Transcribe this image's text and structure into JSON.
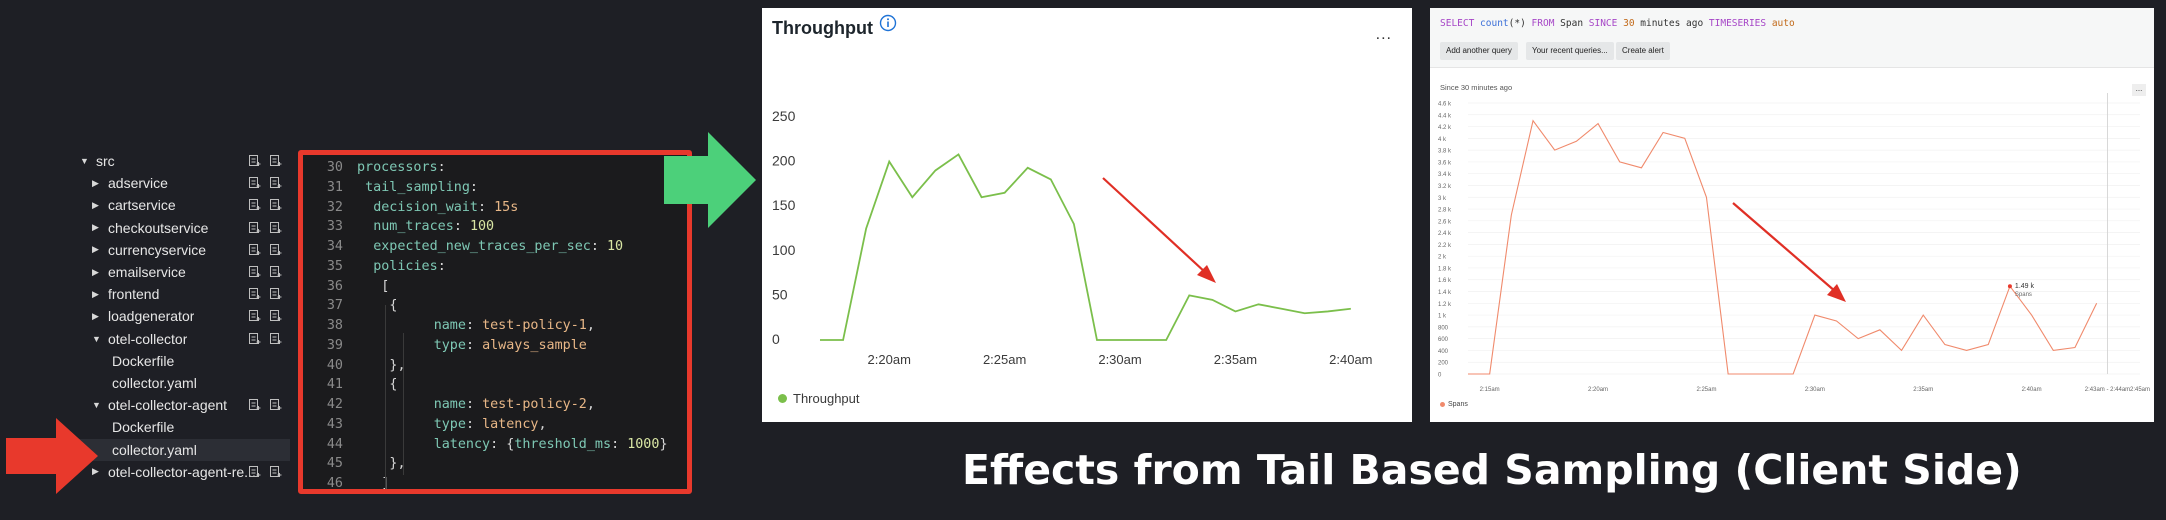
{
  "tree": {
    "items": [
      {
        "label": "src",
        "expanded": true,
        "depth": 0,
        "has_actions": true
      },
      {
        "label": "adservice",
        "expanded": false,
        "depth": 1,
        "has_actions": true
      },
      {
        "label": "cartservice",
        "expanded": false,
        "depth": 1,
        "has_actions": true
      },
      {
        "label": "checkoutservice",
        "expanded": false,
        "depth": 1,
        "has_actions": true
      },
      {
        "label": "currencyservice",
        "expanded": false,
        "depth": 1,
        "has_actions": true
      },
      {
        "label": "emailservice",
        "expanded": false,
        "depth": 1,
        "has_actions": true
      },
      {
        "label": "frontend",
        "expanded": false,
        "depth": 1,
        "has_actions": true
      },
      {
        "label": "loadgenerator",
        "expanded": false,
        "depth": 1,
        "has_actions": true
      },
      {
        "label": "otel-collector",
        "expanded": true,
        "depth": 1,
        "has_actions": true
      },
      {
        "label": "Dockerfile",
        "expanded": null,
        "depth": 2,
        "has_actions": false
      },
      {
        "label": "collector.yaml",
        "expanded": null,
        "depth": 2,
        "has_actions": false
      },
      {
        "label": "otel-collector-agent",
        "expanded": true,
        "depth": 1,
        "has_actions": true
      },
      {
        "label": "Dockerfile",
        "expanded": null,
        "depth": 2,
        "has_actions": false
      },
      {
        "label": "collector.yaml",
        "expanded": null,
        "depth": 2,
        "has_actions": false,
        "selected": true
      },
      {
        "label": "otel-collector-agent-re...",
        "expanded": false,
        "depth": 1,
        "has_actions": true
      }
    ]
  },
  "code": {
    "lines": [
      {
        "n": "30",
        "indent": 0,
        "parts": [
          {
            "t": "processors",
            "c": "k"
          },
          {
            "t": ":",
            "c": "p"
          }
        ]
      },
      {
        "n": "31",
        "indent": 1,
        "parts": [
          {
            "t": "tail_sampling",
            "c": "k"
          },
          {
            "t": ":",
            "c": "p"
          }
        ]
      },
      {
        "n": "32",
        "indent": 2,
        "parts": [
          {
            "t": "decision_wait",
            "c": "k"
          },
          {
            "t": ": ",
            "c": "p"
          },
          {
            "t": "15s",
            "c": "s"
          }
        ]
      },
      {
        "n": "33",
        "indent": 2,
        "parts": [
          {
            "t": "num_traces",
            "c": "k"
          },
          {
            "t": ": ",
            "c": "p"
          },
          {
            "t": "100",
            "c": "n"
          }
        ]
      },
      {
        "n": "34",
        "indent": 2,
        "parts": [
          {
            "t": "expected_new_traces_per_sec",
            "c": "k"
          },
          {
            "t": ": ",
            "c": "p"
          },
          {
            "t": "10",
            "c": "n"
          }
        ]
      },
      {
        "n": "35",
        "indent": 2,
        "parts": [
          {
            "t": "policies",
            "c": "k"
          },
          {
            "t": ":",
            "c": "p"
          }
        ]
      },
      {
        "n": "36",
        "indent": 3,
        "parts": [
          {
            "t": "[",
            "c": "p"
          }
        ]
      },
      {
        "n": "37",
        "indent": 4,
        "parts": [
          {
            "t": "{",
            "c": "p"
          }
        ]
      },
      {
        "n": "38",
        "indent": 7,
        "parts": [
          {
            "t": "name",
            "c": "k"
          },
          {
            "t": ": ",
            "c": "p"
          },
          {
            "t": "test-policy-1",
            "c": "s"
          },
          {
            "t": ",",
            "c": "p"
          }
        ]
      },
      {
        "n": "39",
        "indent": 7,
        "parts": [
          {
            "t": "type",
            "c": "k"
          },
          {
            "t": ": ",
            "c": "p"
          },
          {
            "t": "always_sample",
            "c": "s"
          }
        ]
      },
      {
        "n": "40",
        "indent": 4,
        "parts": [
          {
            "t": "},",
            "c": "p"
          }
        ]
      },
      {
        "n": "41",
        "indent": 4,
        "parts": [
          {
            "t": "{",
            "c": "p"
          }
        ]
      },
      {
        "n": "42",
        "indent": 7,
        "parts": [
          {
            "t": "name",
            "c": "k"
          },
          {
            "t": ": ",
            "c": "p"
          },
          {
            "t": "test-policy-2",
            "c": "s"
          },
          {
            "t": ",",
            "c": "p"
          }
        ]
      },
      {
        "n": "43",
        "indent": 7,
        "parts": [
          {
            "t": "type",
            "c": "k"
          },
          {
            "t": ": ",
            "c": "p"
          },
          {
            "t": "latency",
            "c": "s"
          },
          {
            "t": ",",
            "c": "p"
          }
        ]
      },
      {
        "n": "44",
        "indent": 7,
        "parts": [
          {
            "t": "latency",
            "c": "k"
          },
          {
            "t": ": {",
            "c": "p"
          },
          {
            "t": "threshold_ms",
            "c": "k"
          },
          {
            "t": ": ",
            "c": "p"
          },
          {
            "t": "1000",
            "c": "n"
          },
          {
            "t": "}",
            "c": "p"
          }
        ]
      },
      {
        "n": "45",
        "indent": 4,
        "parts": [
          {
            "t": "},",
            "c": "p"
          }
        ]
      },
      {
        "n": "46",
        "indent": 3,
        "parts": [
          {
            "t": "]",
            "c": "p"
          }
        ]
      }
    ]
  },
  "throughput": {
    "title": "Throughput",
    "info_icon": "info-circle-icon",
    "more_label": "...",
    "legend_label": "Throughput",
    "color": "#7bbf4b"
  },
  "nrql": {
    "query_parts": [
      {
        "t": "SELECT ",
        "c": "q-kw"
      },
      {
        "t": "count",
        "c": "q-fn"
      },
      {
        "t": "(*) ",
        "c": "q-txt"
      },
      {
        "t": "FROM ",
        "c": "q-kw"
      },
      {
        "t": "Span ",
        "c": "q-txt"
      },
      {
        "t": "SINCE ",
        "c": "q-kw"
      },
      {
        "t": "30 ",
        "c": "q-num"
      },
      {
        "t": "minutes ago ",
        "c": "q-txt"
      },
      {
        "t": "TIMESERIES ",
        "c": "q-kw"
      },
      {
        "t": "auto",
        "c": "q-num"
      }
    ],
    "buttons": [
      "Add another query",
      "Your recent queries...",
      "Create alert"
    ],
    "since_label": "Since 30 minutes ago",
    "more_label": "...",
    "legend_label": "Spans",
    "tooltip_value": "1.49 k",
    "tooltip_series": "Spans",
    "color": "#f08a6c"
  },
  "caption": "Effects from Tail Based Sampling (Client Side)",
  "chart_data": [
    {
      "type": "line",
      "title": "Throughput",
      "x": [
        "2:17am",
        "2:18am",
        "2:19am",
        "2:20am",
        "2:21am",
        "2:22am",
        "2:23am",
        "2:24am",
        "2:25am",
        "2:26am",
        "2:27am",
        "2:28am",
        "2:29am",
        "2:30am",
        "2:31am",
        "2:32am",
        "2:33am",
        "2:34am",
        "2:35am",
        "2:36am",
        "2:37am",
        "2:38am",
        "2:39am",
        "2:40am",
        "2:41am",
        "2:42am"
      ],
      "x_tick_labels": [
        "2:20am",
        "2:25am",
        "2:30am",
        "2:35am",
        "2:40am"
      ],
      "series": [
        {
          "name": "Throughput",
          "values": [
            0,
            0,
            125,
            200,
            160,
            190,
            208,
            160,
            165,
            193,
            180,
            130,
            0,
            0,
            0,
            0,
            50,
            45,
            32,
            40,
            35,
            30,
            32,
            35
          ]
        }
      ],
      "ylim": [
        0,
        260
      ],
      "y_ticks": [
        0,
        50,
        100,
        150,
        200,
        250
      ],
      "xlabel": "",
      "ylabel": "",
      "grid": false,
      "legend": "bottom-left"
    },
    {
      "type": "line",
      "x": [
        "2:14am",
        "2:15am",
        "2:16am",
        "2:17am",
        "2:18am",
        "2:19am",
        "2:20am",
        "2:21am",
        "2:22am",
        "2:23am",
        "2:24am",
        "2:25am",
        "2:26am",
        "2:27am",
        "2:28am",
        "2:29am",
        "2:30am",
        "2:31am",
        "2:32am",
        "2:33am",
        "2:34am",
        "2:35am",
        "2:36am",
        "2:37am",
        "2:38am",
        "2:39am",
        "2:40am",
        "2:41am",
        "2:42am",
        "2:43am",
        "2:44am",
        "2:45am"
      ],
      "x_tick_labels": [
        "2:15am",
        "2:20am",
        "2:25am",
        "2:30am",
        "2:35am",
        "2:40am",
        "2:43am - 2:44am",
        "2:45am"
      ],
      "series": [
        {
          "name": "Spans",
          "values": [
            0,
            0,
            2700,
            4300,
            3800,
            3950,
            4250,
            3600,
            3500,
            4100,
            4000,
            3000,
            0,
            0,
            0,
            0,
            1000,
            900,
            600,
            750,
            400,
            1000,
            500,
            400,
            500,
            1490,
            1000,
            400,
            450,
            1200
          ]
        }
      ],
      "ylim": [
        0,
        4600
      ],
      "y_tick_labels": [
        "0",
        "200",
        "400",
        "600",
        "800",
        "1 k",
        "1.2 k",
        "1.4 k",
        "1.6 k",
        "1.8 k",
        "2 k",
        "2.2 k",
        "2.4 k",
        "2.6 k",
        "2.8 k",
        "3 k",
        "3.2 k",
        "3.4 k",
        "3.6 k",
        "3.8 k",
        "4 k",
        "4.2 k",
        "4.4 k",
        "4.6 k"
      ],
      "xlabel": "",
      "ylabel": "",
      "grid": true,
      "legend": "bottom-left"
    }
  ]
}
